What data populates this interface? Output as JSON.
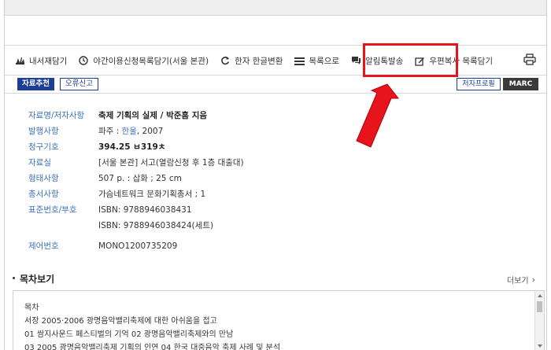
{
  "toolbar": {
    "items": [
      {
        "icon": "bookshelf-icon",
        "label": "내서재담기"
      },
      {
        "icon": "clock-icon",
        "label": "야간이용신청목록담기(서울 본관)"
      },
      {
        "icon": "refresh-icon",
        "label": "한자 한글변환"
      },
      {
        "icon": "list-icon",
        "label": "목록으로"
      },
      {
        "icon": "chat-icon",
        "label": "알림톡발송"
      },
      {
        "icon": "edit-icon",
        "label": "우편복사 목록담기"
      }
    ],
    "print_icon": "printer-icon"
  },
  "subbar": {
    "recommend_label": "자료추천",
    "report_label": "오류신고",
    "author_profile_label": "저자프로필",
    "marc_label": "MARC"
  },
  "record": {
    "title_label": "자료명/저자사항",
    "title_value": "축제 기획의 실제",
    "title_sep": " / ",
    "author_link": "박준흠",
    "author_suffix": " 지음",
    "pub_label": "발행사항",
    "pub_prefix": "파주 : ",
    "pub_link": "한울",
    "pub_suffix": ", 2007",
    "call_label": "청구기호",
    "call_value": "394.25 ㅂ319ㅊ",
    "location_label": "자료실",
    "location_value": "[서울 본관] 서고(열람신청 후 1층 대출대)",
    "form_label": "형태사항",
    "form_value": "507 p. : 삽화 ; 25 cm",
    "series_label": "총서사항",
    "series_value": "가슴네트워크 문화기획총서 ; 1",
    "isbn_label": "표준번호/부호",
    "isbn_1": "ISBN: 9788946038431",
    "isbn_2": "ISBN: 9788946038424(세트)",
    "control_label": "제어번호",
    "control_value": "MONO1200735209"
  },
  "toc": {
    "title": "목차보기",
    "more_label": "더보기",
    "lines": [
      "목차",
      "서장 2005·2006 광명음악밸리축제에 대한 아쉬움을 접고",
      "01 쌈지사운드 페스티벌의 기억 02 광명음악밸리축제와의 만남",
      "03 2005 광명음악밸리축제 기획의 인연 04 한국 대중음악 축제 사례 및 분석"
    ]
  },
  "colors": {
    "accent_blue": "#1c3e96",
    "label_blue": "#3a72b8",
    "highlight_red": "#e8141b"
  }
}
